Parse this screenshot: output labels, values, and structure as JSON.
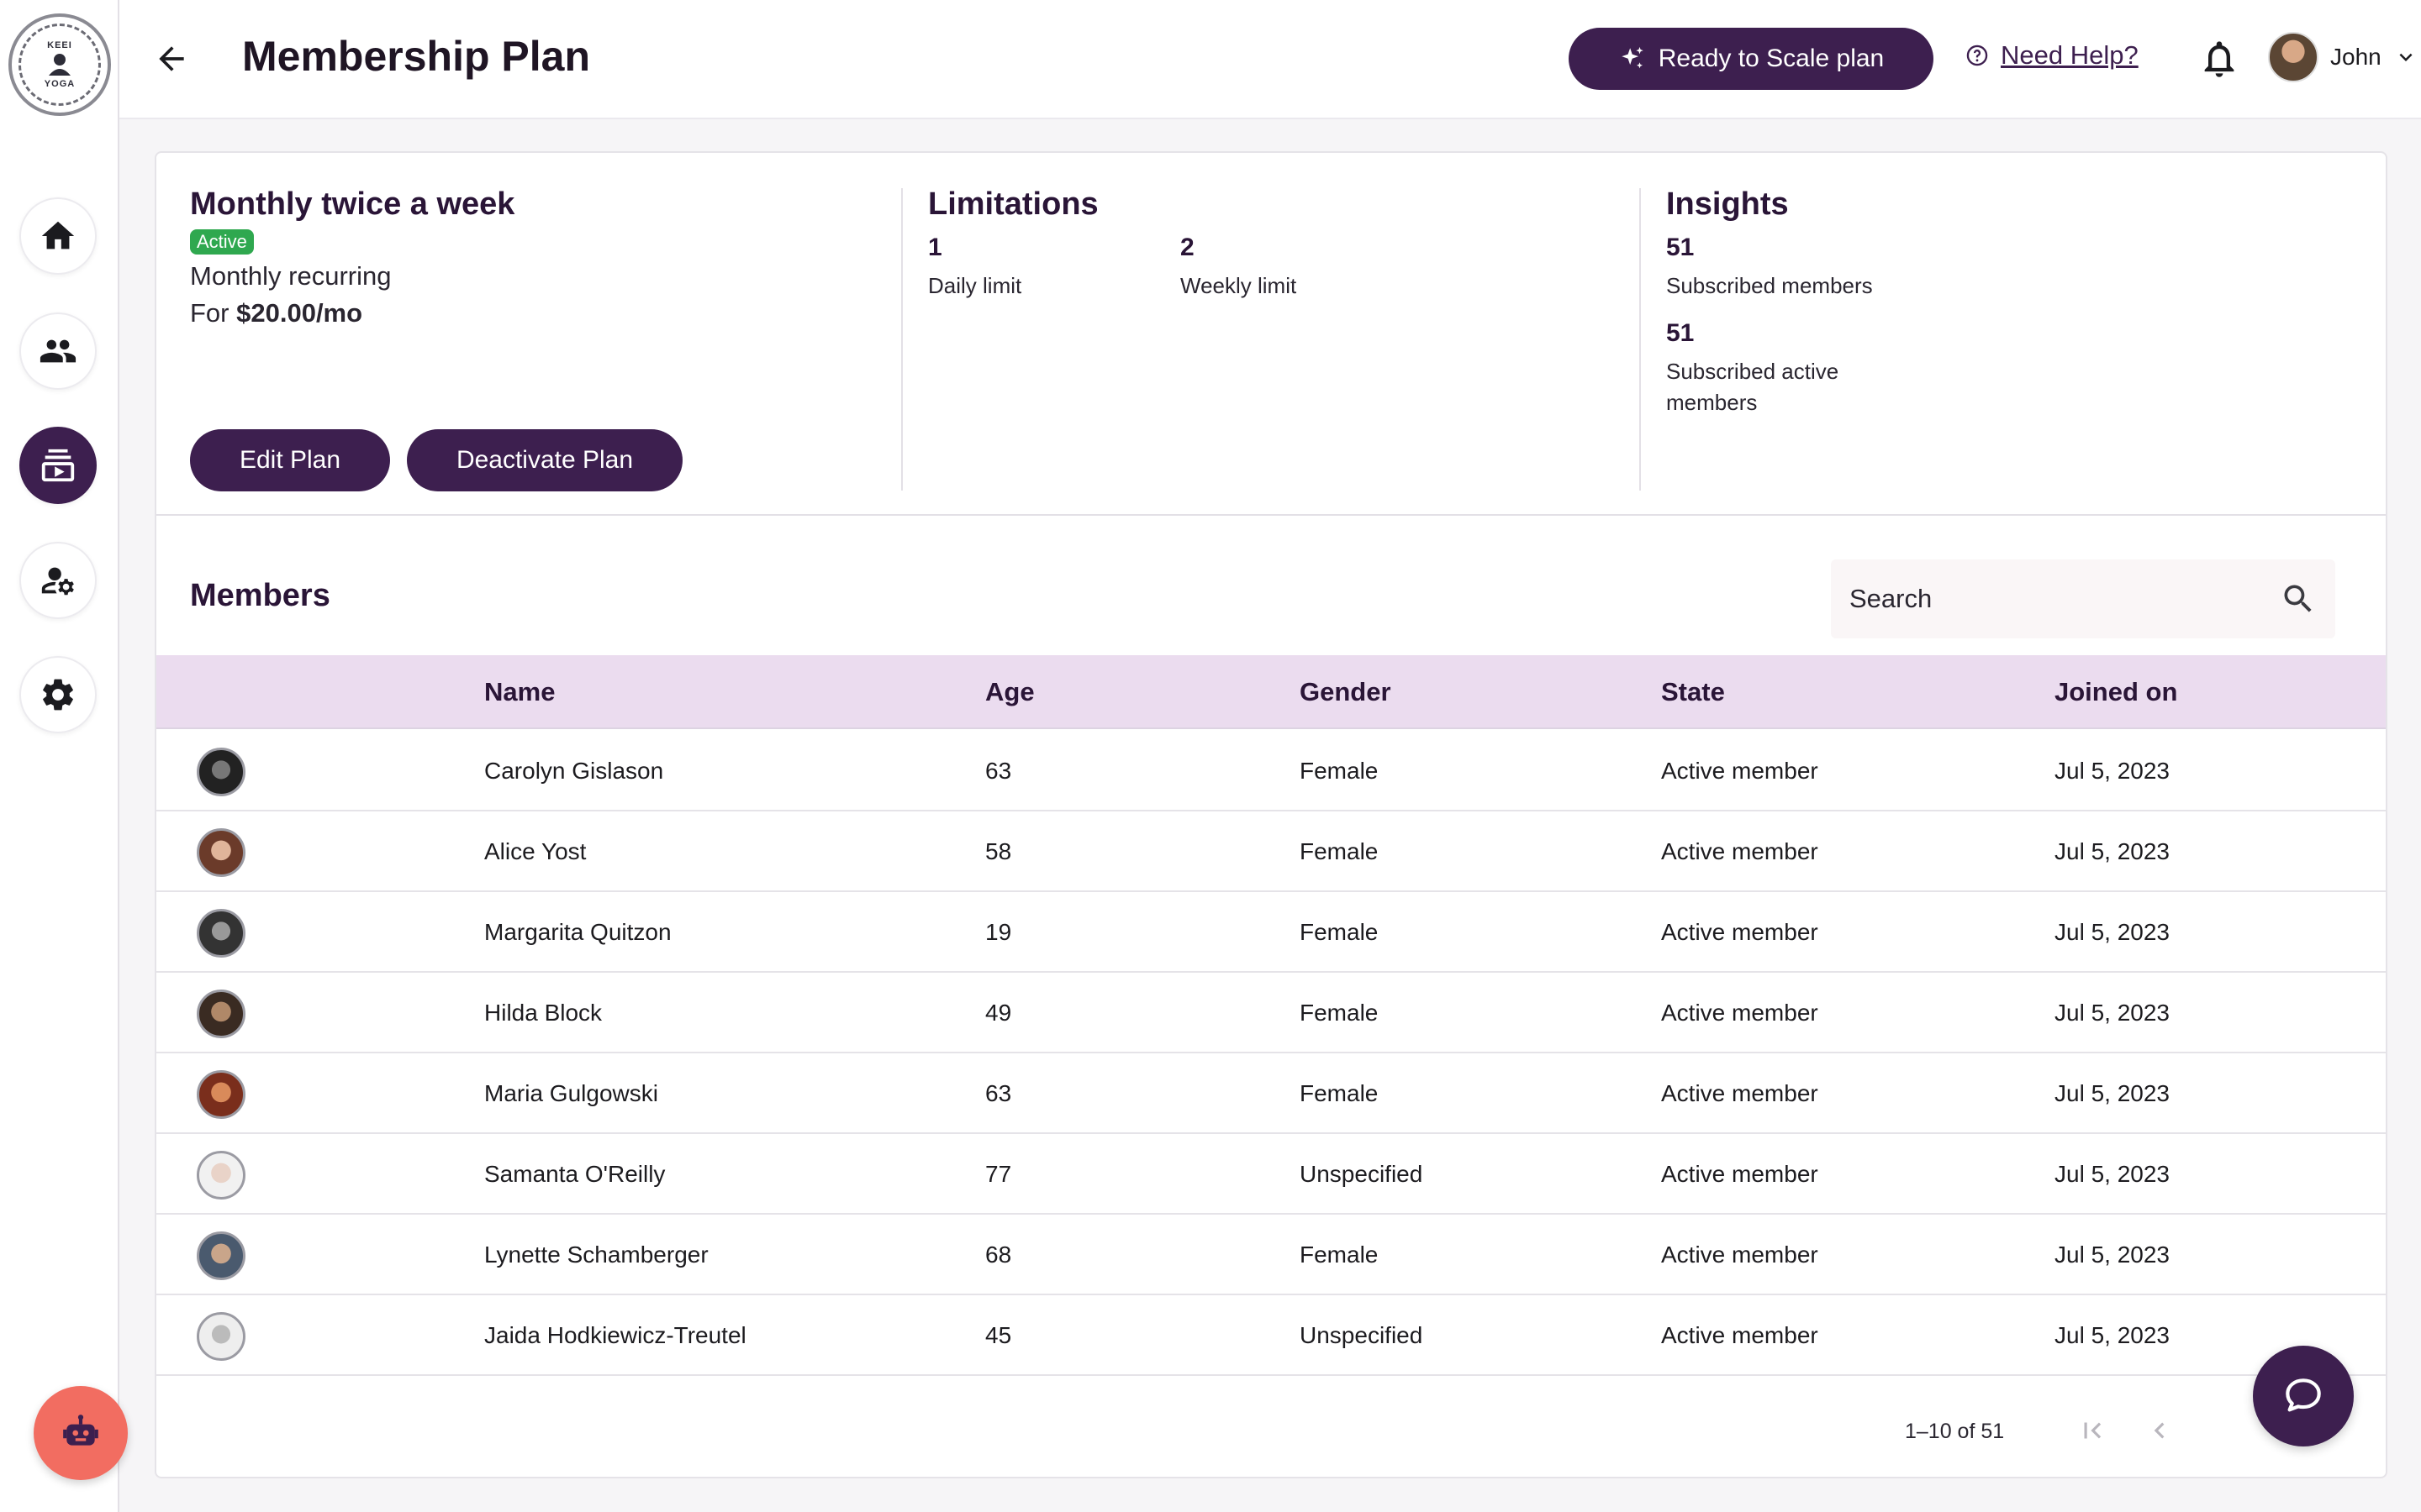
{
  "brand": {
    "logo_text": "YOGA",
    "logo_top": "KEEI"
  },
  "header": {
    "title": "Membership Plan",
    "scale_button": "Ready to Scale plan",
    "help_link": "Need Help?",
    "user_name": "John"
  },
  "plan": {
    "name": "Monthly twice a week",
    "status": "Active",
    "billing": "Monthly recurring",
    "price_prefix": "For",
    "price": "$20.00/mo",
    "edit_button": "Edit Plan",
    "deactivate_button": "Deactivate Plan"
  },
  "limitations": {
    "title": "Limitations",
    "daily_value": "1",
    "daily_label": "Daily limit",
    "weekly_value": "2",
    "weekly_label": "Weekly limit"
  },
  "insights": {
    "title": "Insights",
    "subscribed_value": "51",
    "subscribed_label": "Subscribed members",
    "active_value": "51",
    "active_label_line1": "Subscribed active",
    "active_label_line2": "members"
  },
  "members": {
    "title": "Members",
    "search_placeholder": "Search",
    "columns": [
      "Name",
      "Age",
      "Gender",
      "State",
      "Joined on"
    ],
    "rows": [
      {
        "name": "Carolyn Gislason",
        "age": "63",
        "gender": "Female",
        "state": "Active member",
        "joined": "Jul 5, 2023"
      },
      {
        "name": "Alice Yost",
        "age": "58",
        "gender": "Female",
        "state": "Active member",
        "joined": "Jul 5, 2023"
      },
      {
        "name": "Margarita Quitzon",
        "age": "19",
        "gender": "Female",
        "state": "Active member",
        "joined": "Jul 5, 2023"
      },
      {
        "name": "Hilda Block",
        "age": "49",
        "gender": "Female",
        "state": "Active member",
        "joined": "Jul 5, 2023"
      },
      {
        "name": "Maria Gulgowski",
        "age": "63",
        "gender": "Female",
        "state": "Active member",
        "joined": "Jul 5, 2023"
      },
      {
        "name": "Samanta O'Reilly",
        "age": "77",
        "gender": "Unspecified",
        "state": "Active member",
        "joined": "Jul 5, 2023"
      },
      {
        "name": "Lynette Schamberger",
        "age": "68",
        "gender": "Female",
        "state": "Active member",
        "joined": "Jul 5, 2023"
      },
      {
        "name": "Jaida Hodkiewicz-Treutel",
        "age": "45",
        "gender": "Unspecified",
        "state": "Active member",
        "joined": "Jul 5, 2023"
      }
    ],
    "pagination": "1–10 of 51"
  },
  "colors": {
    "primary": "#3d1f4f",
    "table_header": "#ebdcef",
    "badge": "#2fa84f",
    "bot": "#f26d61"
  }
}
